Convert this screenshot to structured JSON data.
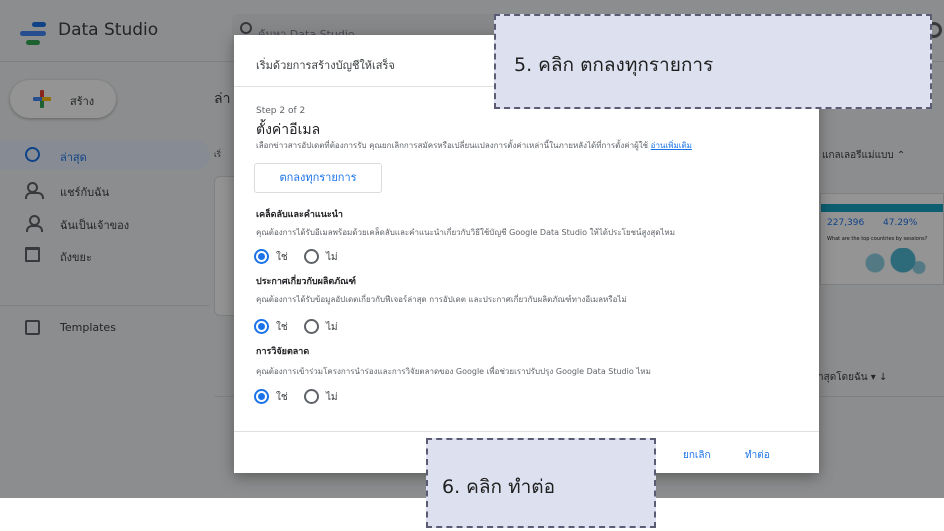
{
  "app": {
    "title": "Data Studio",
    "search_placeholder": "ค้นหา Data Studio",
    "create_label": "สร้าง",
    "nav": [
      {
        "label": "ล่าสุด",
        "icon": "clock-icon"
      },
      {
        "label": "แชร์กับฉัน",
        "icon": "people-icon"
      },
      {
        "label": "ฉันเป็นเจ้าของ",
        "icon": "person-icon"
      },
      {
        "label": "ถังขยะ",
        "icon": "trash-icon"
      },
      {
        "label": "Templates",
        "icon": "template-icon"
      }
    ],
    "bg_heading_fragment": "ล่า",
    "bg_intro_fragment": "เริ่",
    "gallery_label": "แกลเลอรีแม่แบบ ⌃",
    "sort_label": "าสุดโดยฉัน  ▾   ↓",
    "thumb_values": [
      "227,396",
      "47.29%"
    ],
    "thumb_caption": "What are the top countries by sessions?"
  },
  "dialog": {
    "title": "เริ่มด้วยการสร้างบัญชีให้เสร็จ",
    "step": "Step 2 of 2",
    "heading": "ตั้งค่าอีเมล",
    "intro": "เลือกข่าวสารอัปเดตที่ต้องการรับ คุณยกเลิกการสมัครหรือเปลี่ยนแปลงการตั้งค่าเหล่านี้ในภายหลังได้ที่การตั้งค่าผู้ใช้",
    "learn_more": "อ่านเพิ่มเติม",
    "accept_all": "ตกลงทุกรายการ",
    "sections": [
      {
        "title": "เคล็ดลับและคำแนะนำ",
        "description": "คุณต้องการได้รับอีเมลพร้อมด้วยเคล็ดลับและคำแนะนำเกี่ยวกับวิธีใช้บัญชี Google Data Studio ให้ได้ประโยชน์สูงสุดไหม",
        "yes": "ใช่",
        "no": "ไม่",
        "selected": "yes"
      },
      {
        "title": "ประกาศเกี่ยวกับผลิตภัณฑ์",
        "description": "คุณต้องการได้รับข้อมูลอัปเดตเกี่ยวกับฟีเจอร์ล่าสุด การอัปเดต และประกาศเกี่ยวกับผลิตภัณฑ์ทางอีเมลหรือไม่",
        "yes": "ใช่",
        "no": "ไม่",
        "selected": "yes"
      },
      {
        "title": "การวิจัยตลาด",
        "description": "คุณต้องการเข้าร่วมโครงการนำร่องและการวิจัยตลาดของ Google เพื่อช่วยเราปรับปรุง Google Data Studio ไหม",
        "yes": "ใช่",
        "no": "ไม่",
        "selected": "yes"
      }
    ],
    "cancel": "ยกเลิก",
    "continue": "ทำต่อ"
  },
  "callouts": {
    "step5": "5. คลิก ตกลงทุกรายการ",
    "step6": "6. คลิก ทำต่อ"
  },
  "colors": {
    "accent": "#1a73e8",
    "callout_fill": "#dde1ef",
    "callout_border": "#5b5b73"
  }
}
